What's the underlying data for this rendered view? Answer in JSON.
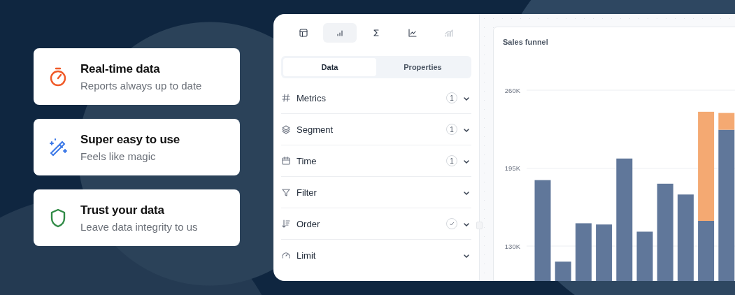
{
  "features": [
    {
      "kind": "timer",
      "title": "Real-time data",
      "subtitle": "Reports always up to date"
    },
    {
      "kind": "wand",
      "title": "Super easy to use",
      "subtitle": "Feels like magic"
    },
    {
      "kind": "shield",
      "title": "Trust your data",
      "subtitle": "Leave data integrity to us"
    }
  ],
  "editor": {
    "chart_types": [
      {
        "kind": "table",
        "selected": false,
        "disabled": false
      },
      {
        "kind": "bar",
        "selected": true,
        "disabled": false
      },
      {
        "kind": "sum",
        "selected": false,
        "disabled": false
      },
      {
        "kind": "line",
        "selected": false,
        "disabled": false
      },
      {
        "kind": "combo",
        "selected": false,
        "disabled": true
      }
    ],
    "tabs": [
      {
        "label": "Data",
        "selected": true
      },
      {
        "label": "Properties",
        "selected": false
      }
    ],
    "sections": [
      {
        "kind": "hash",
        "label": "Metrics",
        "count": "1",
        "checked": false
      },
      {
        "kind": "layers",
        "label": "Segment",
        "count": "1",
        "checked": false
      },
      {
        "kind": "calendar",
        "label": "Time",
        "count": "1",
        "checked": false
      },
      {
        "kind": "filter",
        "label": "Filter",
        "checked": false
      },
      {
        "kind": "sort",
        "label": "Order",
        "checked": true
      },
      {
        "kind": "gauge",
        "label": "Limit",
        "checked": false
      }
    ]
  },
  "chart": {
    "title": "Sales funnel",
    "chart_data": {
      "type": "bar",
      "stacked": true,
      "ylim": [
        0,
        260000
      ],
      "grid": true,
      "yticks": [
        {
          "value": 130000,
          "label": "130K"
        },
        {
          "value": 195000,
          "label": "195K"
        },
        {
          "value": 260000,
          "label": "260K"
        }
      ],
      "series": [
        {
          "color": "#60779a",
          "values": [
            185000,
            117000,
            149000,
            148000,
            203000,
            142000,
            182000,
            173000,
            151000,
            227000
          ]
        },
        {
          "color": "#f4a972",
          "values": [
            null,
            null,
            null,
            null,
            null,
            null,
            null,
            null,
            91000,
            14000
          ]
        }
      ]
    }
  }
}
